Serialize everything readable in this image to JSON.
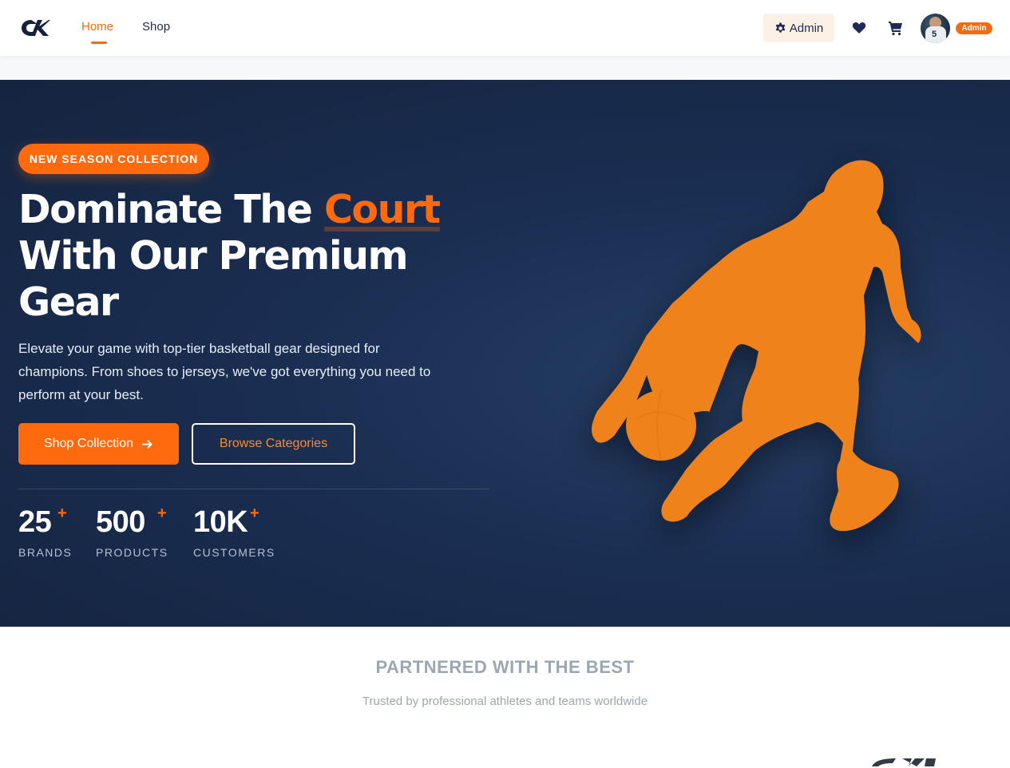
{
  "nav": {
    "links": [
      {
        "label": "Home",
        "active": true
      },
      {
        "label": "Shop",
        "active": false
      }
    ],
    "admin_button": "Admin",
    "role_badge": "Admin",
    "icons": [
      "gear-icon",
      "heart-icon",
      "cart-icon"
    ]
  },
  "hero": {
    "pill": "NEW SEASON COLLECTION",
    "headline_part1": "Dominate The ",
    "headline_accent": "Court",
    "headline_part2": "With Our Premium Gear",
    "description": "Elevate your game with top-tier basketball gear designed for champions. From shoes to jerseys, we've got everything you need to perform at your best.",
    "primary_button": "Shop Collection",
    "secondary_button": "Browse Categories",
    "stats": [
      {
        "value": "25",
        "suffix": "+",
        "label": "BRANDS"
      },
      {
        "value": "500",
        "suffix": "+",
        "label": "PRODUCTS"
      },
      {
        "value": "10K",
        "suffix": "+",
        "label": "CUSTOMERS"
      }
    ]
  },
  "partners": {
    "title": "PARTNERED WITH THE BEST",
    "subtitle": "Trusted by professional athletes and teams worldwide"
  },
  "colors": {
    "accent": "#ff6a0f",
    "navy": "#1a2e52",
    "nav_text": "#1e2a55"
  }
}
